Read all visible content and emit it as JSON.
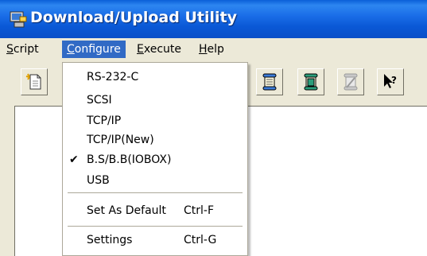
{
  "window": {
    "title": "Download/Upload Utility",
    "icon": "computer-icon"
  },
  "menubar": {
    "items": [
      "Script",
      "Configure",
      "Execute",
      "Help"
    ],
    "active": "Configure"
  },
  "toolbar": {
    "buttons": [
      "new-script-icon",
      "scroll-icon",
      "scroll-icon",
      "scroll-disabled-icon",
      "help-cursor-icon"
    ]
  },
  "dropdown": {
    "items": {
      "rs232c": {
        "label": "RS-232-C"
      },
      "scsi": {
        "label": "SCSI"
      },
      "tcpip": {
        "label": "TCP/IP"
      },
      "tcpip_new": {
        "label": "TCP/IP(New)"
      },
      "bsbb": {
        "label": "B.S/B.B(IOBOX)",
        "checked": true
      },
      "usb": {
        "label": "USB"
      },
      "set_default": {
        "label": "Set As Default",
        "shortcut": "Ctrl-F"
      },
      "settings": {
        "label": "Settings",
        "shortcut": "Ctrl-G"
      }
    }
  },
  "colors": {
    "title_bar": "#0a58d6",
    "menu_highlight": "#316ac5",
    "chrome": "#ece9d8"
  }
}
